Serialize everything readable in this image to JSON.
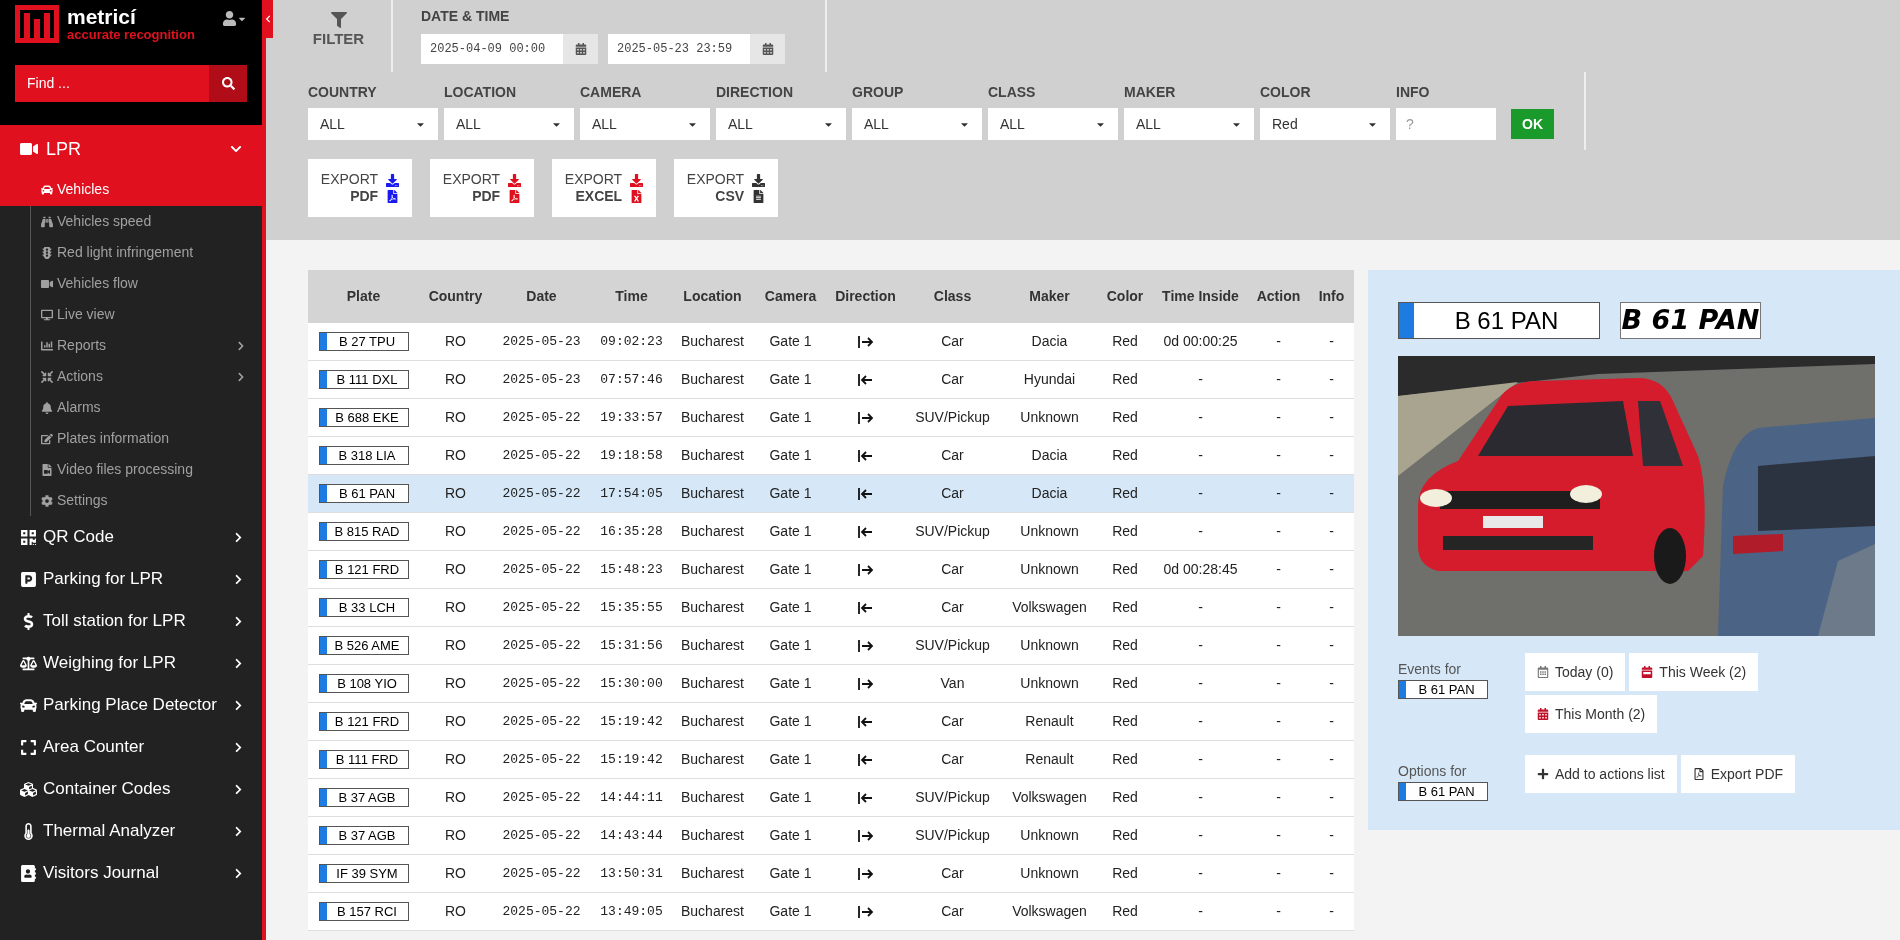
{
  "brand": {
    "name": "metricí",
    "tagline": "accurate recognition"
  },
  "search": {
    "placeholder": "Find ..."
  },
  "menu": [
    {
      "label": "LPR",
      "expanded": true,
      "children": [
        {
          "label": "Vehicles",
          "selected": true,
          "kind": "link"
        },
        {
          "label": "Vehicles speed",
          "selected": false,
          "kind": "link"
        },
        {
          "label": "Red light infringement",
          "selected": false,
          "kind": "link"
        },
        {
          "label": "Vehicles flow",
          "selected": false,
          "kind": "link"
        },
        {
          "label": "Live view",
          "selected": false,
          "kind": "link"
        },
        {
          "label": "Reports",
          "selected": false,
          "kind": "submenu"
        },
        {
          "label": "Actions",
          "selected": false,
          "kind": "submenu"
        },
        {
          "label": "Alarms",
          "selected": false,
          "kind": "link"
        },
        {
          "label": "Plates information",
          "selected": false,
          "kind": "link"
        },
        {
          "label": "Video files processing",
          "selected": false,
          "kind": "link"
        },
        {
          "label": "Settings",
          "selected": false,
          "kind": "link"
        }
      ]
    },
    {
      "label": "QR Code",
      "expanded": false
    },
    {
      "label": "Parking for LPR",
      "expanded": false
    },
    {
      "label": "Toll station for LPR",
      "expanded": false
    },
    {
      "label": "Weighing for LPR",
      "expanded": false
    },
    {
      "label": "Parking Place Detector",
      "expanded": false
    },
    {
      "label": "Area Counter",
      "expanded": false
    },
    {
      "label": "Container Codes",
      "expanded": false
    },
    {
      "label": "Thermal Analyzer",
      "expanded": false
    },
    {
      "label": "Visitors Journal",
      "expanded": false
    }
  ],
  "filter": {
    "title": "FILTER",
    "date_time": {
      "label": "DATE & TIME",
      "from": "2025-04-09 00:00",
      "to": "2025-05-23 23:59"
    },
    "fields": [
      {
        "label": "COUNTRY",
        "value": "ALL",
        "kind": "select"
      },
      {
        "label": "LOCATION",
        "value": "ALL",
        "kind": "select"
      },
      {
        "label": "CAMERA",
        "value": "ALL",
        "kind": "select"
      },
      {
        "label": "DIRECTION",
        "value": "ALL",
        "kind": "select"
      },
      {
        "label": "GROUP",
        "value": "ALL",
        "kind": "select"
      },
      {
        "label": "CLASS",
        "value": "ALL",
        "kind": "select"
      },
      {
        "label": "MAKER",
        "value": "ALL",
        "kind": "select"
      },
      {
        "label": "COLOR",
        "value": "Red",
        "kind": "select"
      },
      {
        "label": "INFO",
        "placeholder": "?",
        "kind": "text"
      }
    ],
    "ok_button": "OK",
    "exports": [
      {
        "label": "EXPORT",
        "format": "PDF",
        "color": "#1a1af0"
      },
      {
        "label": "EXPORT",
        "format": "PDF",
        "color": "#e0101e"
      },
      {
        "label": "EXPORT",
        "format": "EXCEL",
        "color": "#e0101e"
      },
      {
        "label": "EXPORT",
        "format": "CSV",
        "color": "#333333"
      }
    ]
  },
  "table": {
    "columns": [
      "Plate",
      "Country",
      "Date",
      "Time",
      "Location",
      "Camera",
      "Direction",
      "Class",
      "Maker",
      "Color",
      "Time Inside",
      "Action",
      "Info"
    ],
    "rows": [
      {
        "plate": "B 27 TPU",
        "country": "RO",
        "date": "2025-05-23",
        "time": "09:02:23",
        "location": "Bucharest",
        "camera": "Gate 1",
        "kind": "exit",
        "class": "Car",
        "maker": "Dacia",
        "vehicle_color": "Red",
        "time_inside": "0d 00:00:25",
        "action": "-",
        "info": "-",
        "selected": false
      },
      {
        "plate": "B 111 DXL",
        "country": "RO",
        "date": "2025-05-23",
        "time": "07:57:46",
        "location": "Bucharest",
        "camera": "Gate 1",
        "kind": "entry",
        "class": "Car",
        "maker": "Hyundai",
        "vehicle_color": "Red",
        "time_inside": "-",
        "action": "-",
        "info": "-",
        "selected": false
      },
      {
        "plate": "B 688 EKE",
        "country": "RO",
        "date": "2025-05-22",
        "time": "19:33:57",
        "location": "Bucharest",
        "camera": "Gate 1",
        "kind": "exit",
        "class": "SUV/Pickup",
        "maker": "Unknown",
        "vehicle_color": "Red",
        "time_inside": "-",
        "action": "-",
        "info": "-",
        "selected": false
      },
      {
        "plate": "B 318 LIA",
        "country": "RO",
        "date": "2025-05-22",
        "time": "19:18:58",
        "location": "Bucharest",
        "camera": "Gate 1",
        "kind": "entry",
        "class": "Car",
        "maker": "Dacia",
        "vehicle_color": "Red",
        "time_inside": "-",
        "action": "-",
        "info": "-",
        "selected": false
      },
      {
        "plate": "B 61 PAN",
        "country": "RO",
        "date": "2025-05-22",
        "time": "17:54:05",
        "location": "Bucharest",
        "camera": "Gate 1",
        "kind": "entry",
        "class": "Car",
        "maker": "Dacia",
        "vehicle_color": "Red",
        "time_inside": "-",
        "action": "-",
        "info": "-",
        "selected": true
      },
      {
        "plate": "B 815 RAD",
        "country": "RO",
        "date": "2025-05-22",
        "time": "16:35:28",
        "location": "Bucharest",
        "camera": "Gate 1",
        "kind": "entry",
        "class": "SUV/Pickup",
        "maker": "Unknown",
        "vehicle_color": "Red",
        "time_inside": "-",
        "action": "-",
        "info": "-",
        "selected": false
      },
      {
        "plate": "B 121 FRD",
        "country": "RO",
        "date": "2025-05-22",
        "time": "15:48:23",
        "location": "Bucharest",
        "camera": "Gate 1",
        "kind": "exit",
        "class": "Car",
        "maker": "Unknown",
        "vehicle_color": "Red",
        "time_inside": "0d 00:28:45",
        "action": "-",
        "info": "-",
        "selected": false
      },
      {
        "plate": "B 33 LCH",
        "country": "RO",
        "date": "2025-05-22",
        "time": "15:35:55",
        "location": "Bucharest",
        "camera": "Gate 1",
        "kind": "entry",
        "class": "Car",
        "maker": "Volkswagen",
        "vehicle_color": "Red",
        "time_inside": "-",
        "action": "-",
        "info": "-",
        "selected": false
      },
      {
        "plate": "B 526 AME",
        "country": "RO",
        "date": "2025-05-22",
        "time": "15:31:56",
        "location": "Bucharest",
        "camera": "Gate 1",
        "kind": "exit",
        "class": "SUV/Pickup",
        "maker": "Unknown",
        "vehicle_color": "Red",
        "time_inside": "-",
        "action": "-",
        "info": "-",
        "selected": false
      },
      {
        "plate": "B 108 YIO",
        "country": "RO",
        "date": "2025-05-22",
        "time": "15:30:00",
        "location": "Bucharest",
        "camera": "Gate 1",
        "kind": "exit",
        "class": "Van",
        "maker": "Unknown",
        "vehicle_color": "Red",
        "time_inside": "-",
        "action": "-",
        "info": "-",
        "selected": false
      },
      {
        "plate": "B 121 FRD",
        "country": "RO",
        "date": "2025-05-22",
        "time": "15:19:42",
        "location": "Bucharest",
        "camera": "Gate 1",
        "kind": "entry",
        "class": "Car",
        "maker": "Renault",
        "vehicle_color": "Red",
        "time_inside": "-",
        "action": "-",
        "info": "-",
        "selected": false
      },
      {
        "plate": "B 111 FRD",
        "country": "RO",
        "date": "2025-05-22",
        "time": "15:19:42",
        "location": "Bucharest",
        "camera": "Gate 1",
        "kind": "entry",
        "class": "Car",
        "maker": "Renault",
        "vehicle_color": "Red",
        "time_inside": "-",
        "action": "-",
        "info": "-",
        "selected": false
      },
      {
        "plate": "B 37 AGB",
        "country": "RO",
        "date": "2025-05-22",
        "time": "14:44:11",
        "location": "Bucharest",
        "camera": "Gate 1",
        "kind": "entry",
        "class": "SUV/Pickup",
        "maker": "Volkswagen",
        "vehicle_color": "Red",
        "time_inside": "-",
        "action": "-",
        "info": "-",
        "selected": false
      },
      {
        "plate": "B 37 AGB",
        "country": "RO",
        "date": "2025-05-22",
        "time": "14:43:44",
        "location": "Bucharest",
        "camera": "Gate 1",
        "kind": "exit",
        "class": "SUV/Pickup",
        "maker": "Unknown",
        "vehicle_color": "Red",
        "time_inside": "-",
        "action": "-",
        "info": "-",
        "selected": false
      },
      {
        "plate": "IF 39 SYM",
        "country": "RO",
        "date": "2025-05-22",
        "time": "13:50:31",
        "location": "Bucharest",
        "camera": "Gate 1",
        "kind": "exit",
        "class": "Car",
        "maker": "Unknown",
        "vehicle_color": "Red",
        "time_inside": "-",
        "action": "-",
        "info": "-",
        "selected": false
      },
      {
        "plate": "B 157 RCI",
        "country": "RO",
        "date": "2025-05-22",
        "time": "13:49:05",
        "location": "Bucharest",
        "camera": "Gate 1",
        "kind": "exit",
        "class": "Car",
        "maker": "Volkswagen",
        "vehicle_color": "Red",
        "time_inside": "-",
        "action": "-",
        "info": "-",
        "selected": false
      }
    ]
  },
  "details": {
    "plate": "B 61 PAN",
    "plate_crop": "B 61 PAN",
    "photo": {
      "kind": "picture"
    },
    "events_label": "Events for",
    "events_plate": "B 61 PAN",
    "event_buttons": [
      "Today (0)",
      "This Week (2)",
      "This Month (2)"
    ],
    "options_label": "Options for",
    "options_plate": "B 61 PAN",
    "option_buttons": [
      "Add to actions list",
      "Export PDF"
    ]
  }
}
